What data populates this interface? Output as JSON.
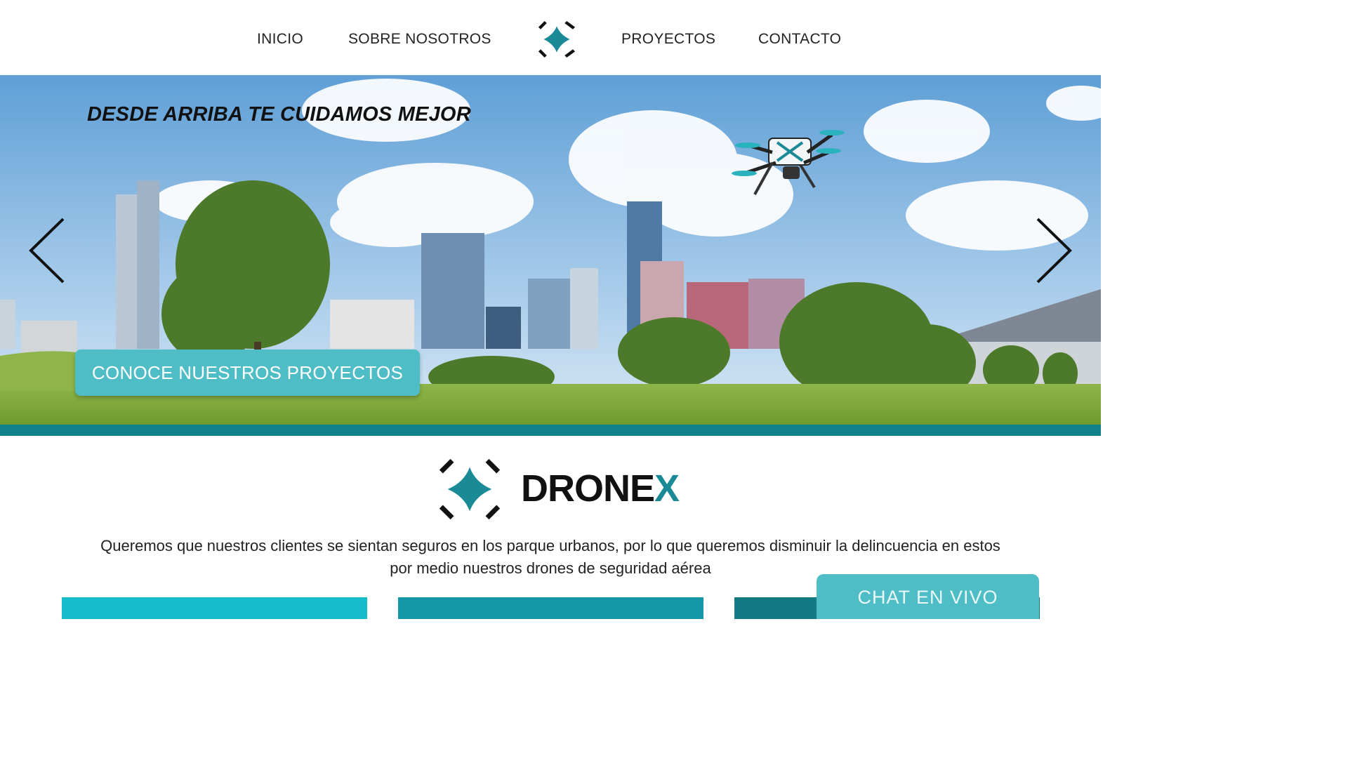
{
  "nav": {
    "items": [
      {
        "label": "INICIO"
      },
      {
        "label": "SOBRE NOSOTROS"
      },
      {
        "label": "PROYECTOS"
      },
      {
        "label": "CONTACTO"
      }
    ],
    "logo_icon": "drone-logo-icon"
  },
  "hero": {
    "tagline": "DESDE ARRIBA TE CUIDAMOS MEJOR",
    "cta_label": "CONOCE NUESTROS PROYECTOS",
    "prev_icon": "chevron-left-icon",
    "next_icon": "chevron-right-icon"
  },
  "brand": {
    "name_main": "DRONE",
    "name_accent": "X",
    "description": "Queremos que nuestros clientes se sientan seguros en los parque urbanos, por lo que queremos disminuir la delincuencia en estos por medio nuestros drones de seguridad aérea"
  },
  "chat": {
    "label": "CHAT EN VIVO"
  },
  "colors": {
    "accent": "#4fbdc6",
    "teal_dark": "#11818c",
    "card_1": "#17bccb",
    "card_2": "#1497a6",
    "card_3": "#137a84"
  }
}
